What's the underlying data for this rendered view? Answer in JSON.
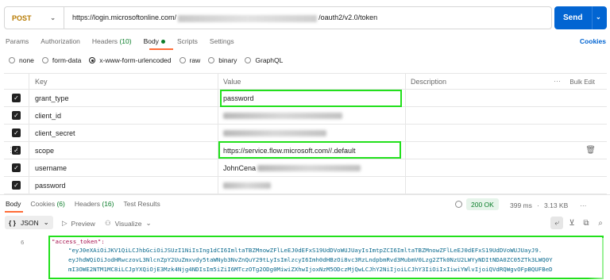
{
  "request": {
    "method": "POST",
    "url_prefix": "https://login.microsoftonline.com/",
    "url_suffix": "/oauth2/v2.0/token",
    "send_label": "Send"
  },
  "tabs": {
    "params": "Params",
    "authorization": "Authorization",
    "headers": "Headers",
    "headers_count": "(10)",
    "body": "Body",
    "scripts": "Scripts",
    "settings": "Settings",
    "cookies": "Cookies"
  },
  "body_types": [
    "none",
    "form-data",
    "x-www-form-urlencoded",
    "raw",
    "binary",
    "GraphQL"
  ],
  "table": {
    "headers": {
      "key": "Key",
      "value": "Value",
      "description": "Description",
      "bulk_edit": "Bulk Edit"
    },
    "rows": [
      {
        "key": "grant_type",
        "value": "password"
      },
      {
        "key": "client_id",
        "value": ""
      },
      {
        "key": "client_secret",
        "value": ""
      },
      {
        "key": "scope",
        "value": "https://service.flow.microsoft.com//.default"
      },
      {
        "key": "username",
        "value": "JohnCena"
      },
      {
        "key": "password",
        "value": ""
      }
    ]
  },
  "response": {
    "tabs": [
      "Body",
      "Cookies",
      "(6)",
      "Headers",
      "(16)",
      "Test Results"
    ],
    "status": "200 OK",
    "time": "399 ms",
    "size": "3.13 KB",
    "more": "···",
    "format": "JSON",
    "preview": "Preview",
    "visualize": "Visualize",
    "line_number": "6",
    "token_key": "\"access_token\":",
    "token_lines": [
      "\"eyJ0eXAiOiJKV1QiLCJhbGciOiJSUzI1NiIsIng1dCI6ImltaTBZMnowZFlLeEJ0dEFxS19UdDVoWUJUayIsImtpZCI6ImltaTBZMnowZFlLeEJ0dEFxS19UdDVoWUJUayJ9.",
      "eyJhdWQiOiJodHRwczovL3NlcnZpY2UuZmxvdy5taWNyb3NvZnQuY29tLyIsImlzcyI6Imh0dHBzOi8vc3RzLndpbmRvd3MubmV0Lzg2ZTk0NzU2LWYyNDItNDA0ZC05ZTk3LWQ0Y",
      "mI3OWE2NTM1MC8iLCJpYXQiOjE3Mzk4Njg4NDIsIm5iZiI6MTczOTg2ODg0MiwiZXhwIjoxNzM5ODczMjQwLCJhY2NiIjoiLCJhY3IiOiIxIiwiYWlvIjoiQVdRQWgvOFpBQUFBeD"
    ]
  }
}
